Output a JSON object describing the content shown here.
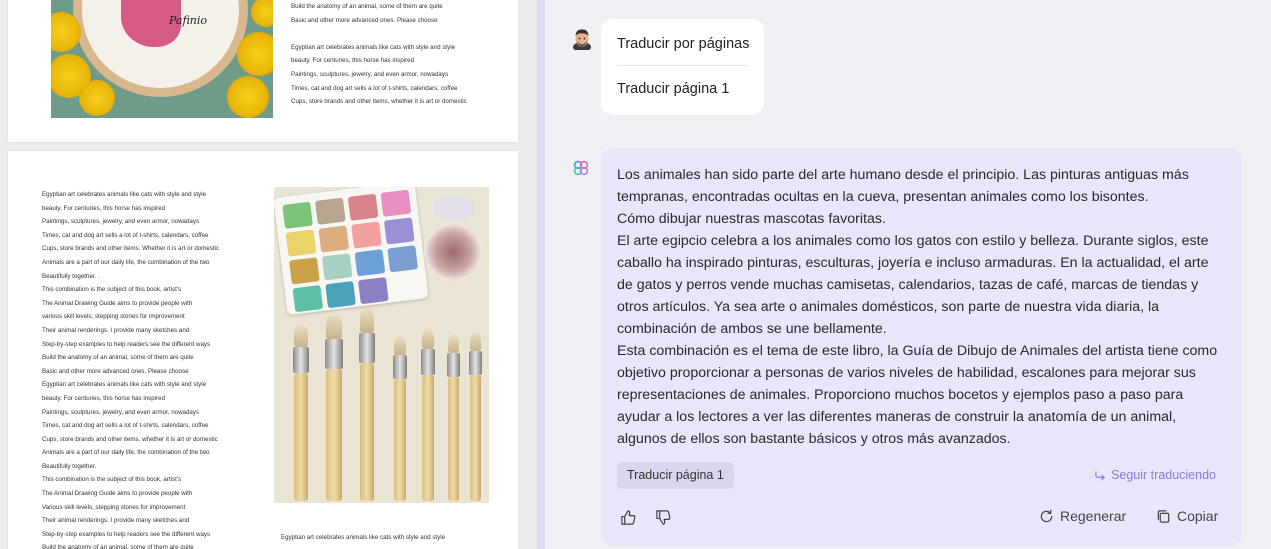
{
  "pdf": {
    "page1": {
      "right_lines": [
        "Build the anatomy of an animal, some of them are quite",
        "Basic and other more advanced ones. Please choose",
        "",
        "Egyptian art celebrates animals like cats with style and style",
        "beauty. For centuries, this horse has inspired",
        "Paintings, sculptures, jewelry, and even armor, nowadays",
        "Times, cat and dog art sells a lot of t-shirts, calendars, coffee",
        "Cups, store brands and other items, whether it is art or domestic"
      ],
      "hoop_text": "Pafinio"
    },
    "page2": {
      "left_lines": [
        "Egyptian art celebrates animals like cats with style and style",
        "beauty. For centuries, this horse has inspired",
        "Paintings, sculptures, jewelry, and even armor, nowadays",
        "Times, cat and dog art sells a lot of t-shirts, calendars, coffee",
        "Cups, store brands and other items. Whether it is art or domestic",
        "Animals are a part of our daily life, the combination of the two",
        "Beautifully together.  .",
        "This combination is the subject of this book, artist's",
        "The Animal Drawing Guide aims to provide people with",
        "various skill levels, stepping stones for improvement",
        "Their animal renderings. I provide many sketches and",
        "Step-by-step examples to help readers see the different ways",
        "Build the anatomy of an animal, some of them are quite",
        "Basic and other more advanced ones. Please choose",
        "Egyptian art celebrates animals like cats with style and style",
        "beauty. For centuries, this horse has inspired",
        "Paintings, sculptures, jewelry, and even armor, nowadays",
        "Times, cat and dog art sells a lot of t-shirts, calendars, coffee",
        "Cups, store brands and other items. whether it is art or domestic",
        "Animals are a part of our daily life, the combination of the two",
        "Beautifully together.",
        "This combination is the subject of this book, artist's",
        "The Animal Drawing Guide aims to provide people with",
        "Various skill levels, stepping stones for improvement",
        "Their animal renderings. I provide many sketches and",
        "Step-by-step examples to help readers see the different ways",
        "Build the anatomy of an animal, some of them are quite"
      ],
      "caption": "Egyptian art celebrates animals like cats with style and style"
    }
  },
  "chat": {
    "user_message": {
      "line1": "Traducir por páginas",
      "line2": "Traducir página 1"
    },
    "bot_message": {
      "lines": [
        "Los animales han sido parte del arte humano desde el principio. Las pinturas antiguas más",
        "tempranas, encontradas ocultas en la cueva, presentan animales como los bisontes.",
        "Cómo dibujar nuestras mascotas favoritas.",
        "El arte egipcio celebra a los animales como los gatos con estilo y belleza. Durante siglos, este",
        "caballo ha inspirado pinturas, esculturas, joyería e incluso armaduras. En la actualidad, el arte",
        "de gatos y perros vende muchas camisetas, calendarios, tazas de café, marcas de tiendas y",
        "otros artículos. Ya sea arte o animales domésticos, son parte de nuestra vida diaria, la",
        "combinación de ambos se une bellamente.",
        "Esta combinación es el tema de este libro, la Guía de Dibujo de Animales del artista tiene como",
        "objetivo proporcionar a personas de varios niveles de habilidad, escalones para mejorar sus",
        "representaciones de animales. Proporciono muchos bocetos y ejemplos paso a paso para",
        "ayudar a los lectores a ver las diferentes maneras de construir la anatomía de un animal,",
        "algunos de ellos son bastante básicos y otros más avanzados."
      ],
      "chip_label": "Traducir página 1",
      "continue_label": "Seguir traduciendo",
      "regenerate_label": "Regenerar",
      "copy_label": "Copiar"
    }
  },
  "colors": {
    "bot_bubble": "#e8e6fb",
    "accent": "#8b7ae0",
    "background": "#f1f1f5"
  },
  "icons": [
    "avatar",
    "assistant-logo-icon",
    "reply-arrow-icon",
    "thumbs-up-icon",
    "thumbs-down-icon",
    "refresh-icon",
    "copy-icon"
  ]
}
